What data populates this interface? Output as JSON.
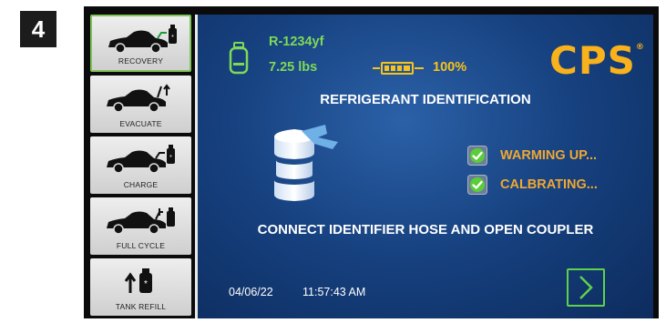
{
  "step_badge": "4",
  "sidebar": {
    "items": [
      {
        "label": "RECOVERY",
        "icon": "car-recovery-icon",
        "active": true
      },
      {
        "label": "EVACUATE",
        "icon": "car-evacuate-icon",
        "active": false
      },
      {
        "label": "CHARGE",
        "icon": "car-charge-icon",
        "active": false
      },
      {
        "label": "FULL CYCLE",
        "icon": "car-full-cycle-icon",
        "active": false
      },
      {
        "label": "TANK REFILL",
        "icon": "tank-refill-icon",
        "active": false
      }
    ]
  },
  "header": {
    "refrigerant": "R-1234yf",
    "weight": "7.25 lbs",
    "battery": "100%",
    "brand": "CPS"
  },
  "main": {
    "title": "REFRIGERANT IDENTIFICATION",
    "statuses": [
      {
        "text": "WARMING UP...",
        "checked": true
      },
      {
        "text": "CALBRATING...",
        "checked": true
      }
    ],
    "instruction": "CONNECT IDENTIFIER HOSE AND OPEN COUPLER"
  },
  "footer": {
    "date": "04/06/22",
    "time": "11:57:43 AM"
  },
  "colors": {
    "screen_blue": "#16407e",
    "accent_green": "#7ed957",
    "status_orange": "#f0a832",
    "brand_yellow": "#f9b21b"
  }
}
